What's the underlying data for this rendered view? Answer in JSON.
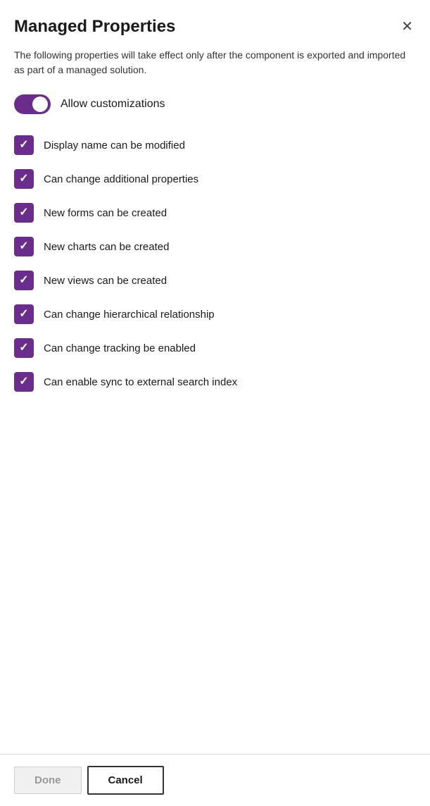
{
  "dialog": {
    "title": "Managed Properties",
    "description": "The following properties will take effect only after the component is exported and imported as part of a managed solution.",
    "close_label": "✕"
  },
  "toggle": {
    "label": "Allow customizations",
    "checked": true
  },
  "checkboxes": [
    {
      "id": "cb1",
      "label": "Display name can be modified",
      "checked": true
    },
    {
      "id": "cb2",
      "label": "Can change additional properties",
      "checked": true
    },
    {
      "id": "cb3",
      "label": "New forms can be created",
      "checked": true
    },
    {
      "id": "cb4",
      "label": "New charts can be created",
      "checked": true
    },
    {
      "id": "cb5",
      "label": "New views can be created",
      "checked": true
    },
    {
      "id": "cb6",
      "label": "Can change hierarchical relationship",
      "checked": true
    },
    {
      "id": "cb7",
      "label": "Can change tracking be enabled",
      "checked": true
    },
    {
      "id": "cb8",
      "label": "Can enable sync to external search index",
      "checked": true
    }
  ],
  "footer": {
    "done_label": "Done",
    "cancel_label": "Cancel"
  }
}
